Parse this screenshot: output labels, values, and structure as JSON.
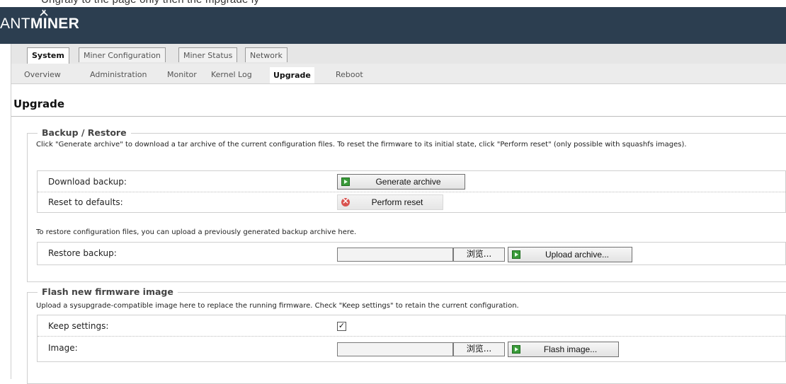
{
  "header": {
    "top_strip_text": "Ungraly to the page only then the mpgrade ly",
    "logo_light": "ANT",
    "logo_bold": "MINER"
  },
  "tabs": [
    {
      "label": "System",
      "active": true
    },
    {
      "label": "Miner Configuration",
      "active": false
    },
    {
      "label": "Miner Status",
      "active": false
    },
    {
      "label": "Network",
      "active": false
    }
  ],
  "subtabs": [
    {
      "label": "Overview",
      "active": false
    },
    {
      "label": "Administration",
      "active": false
    },
    {
      "label": "Monitor",
      "active": false
    },
    {
      "label": "Kernel Log",
      "active": false
    },
    {
      "label": "Upgrade",
      "active": true
    },
    {
      "label": "Reboot",
      "active": false
    }
  ],
  "page": {
    "title": "Upgrade"
  },
  "backup": {
    "legend": "Backup / Restore",
    "description": "Click \"Generate archive\" to download a tar archive of the current configuration files. To reset the firmware to its initial state, click \"Perform reset\" (only possible with squashfs images).",
    "download_label": "Download backup:",
    "generate_button": "Generate archive",
    "reset_label": "Reset to defaults:",
    "reset_button": "Perform reset",
    "restore_description": "To restore configuration files, you can upload a previously generated backup archive here.",
    "restore_label": "Restore backup:",
    "browse_button": "浏览...",
    "upload_button": "Upload archive..."
  },
  "flash": {
    "legend": "Flash new firmware image",
    "description": "Upload a sysupgrade-compatible image here to replace the running firmware. Check \"Keep settings\" to retain the current configuration.",
    "keep_label": "Keep settings:",
    "keep_checked": true,
    "keep_mark": "✓",
    "image_label": "Image:",
    "browse_button": "浏览...",
    "flash_button": "Flash image..."
  },
  "icons": {
    "go": "play-icon",
    "reset": "reset-icon"
  },
  "colors": {
    "header_bg": "#2c3e50",
    "icon_green": "#3a9b3a",
    "icon_red": "#d9534f"
  }
}
